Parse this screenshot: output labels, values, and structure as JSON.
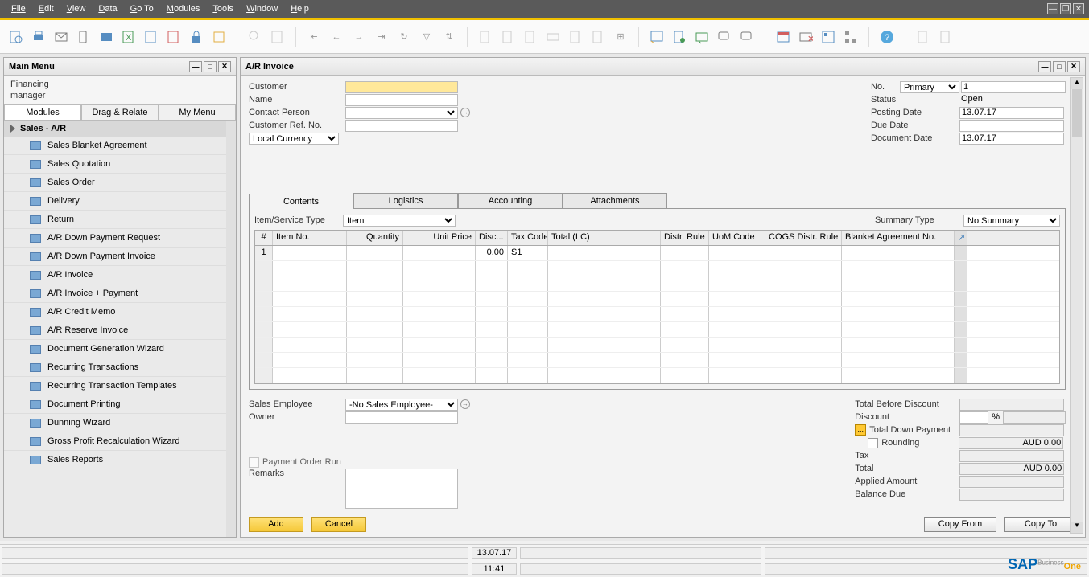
{
  "menubar": [
    "File",
    "Edit",
    "View",
    "Data",
    "Go To",
    "Modules",
    "Tools",
    "Window",
    "Help"
  ],
  "mainmenu": {
    "title": "Main Menu",
    "user_line1": "Financing",
    "user_line2": "manager",
    "tabs": [
      "Modules",
      "Drag & Relate",
      "My Menu"
    ],
    "section": "Sales - A/R",
    "items": [
      "Sales Blanket Agreement",
      "Sales Quotation",
      "Sales Order",
      "Delivery",
      "Return",
      "A/R Down Payment Request",
      "A/R Down Payment Invoice",
      "A/R Invoice",
      "A/R Invoice + Payment",
      "A/R Credit Memo",
      "A/R Reserve Invoice",
      "Document Generation Wizard",
      "Recurring Transactions",
      "Recurring Transaction Templates",
      "Document Printing",
      "Dunning Wizard",
      "Gross Profit Recalculation Wizard",
      "Sales Reports"
    ]
  },
  "invoice": {
    "title": "A/R Invoice",
    "left_fields": {
      "customer_label": "Customer",
      "name_label": "Name",
      "contact_label": "Contact Person",
      "ref_label": "Customer Ref. No.",
      "currency": "Local Currency"
    },
    "right_fields": {
      "no_label": "No.",
      "no_type": "Primary",
      "no_value": "1",
      "status_label": "Status",
      "status_value": "Open",
      "posting_label": "Posting Date",
      "posting_value": "13.07.17",
      "due_label": "Due Date",
      "due_value": "",
      "doc_label": "Document Date",
      "doc_value": "13.07.17"
    },
    "tabs": [
      "Contents",
      "Logistics",
      "Accounting",
      "Attachments"
    ],
    "type_row": {
      "item_service_label": "Item/Service Type",
      "item_service_value": "Item",
      "summary_label": "Summary Type",
      "summary_value": "No Summary"
    },
    "grid_headers": [
      "#",
      "Item No.",
      "Quantity",
      "Unit Price",
      "Disc...",
      "Tax Code",
      "Total (LC)",
      "Distr. Rule",
      "UoM Code",
      "COGS Distr. Rule",
      "Blanket Agreement No."
    ],
    "grid_row1": {
      "num": "1",
      "disc": "0.00",
      "tax": "S1"
    },
    "bottom_left": {
      "sales_emp_label": "Sales Employee",
      "sales_emp_value": "-No Sales Employee-",
      "owner_label": "Owner",
      "payment_order_label": "Payment Order Run",
      "remarks_label": "Remarks"
    },
    "bottom_right": {
      "total_before_label": "Total Before Discount",
      "discount_label": "Discount",
      "discount_pct": "%",
      "total_down_label": "Total Down Payment",
      "rounding_label": "Rounding",
      "rounding_value": "AUD 0.00",
      "tax_label": "Tax",
      "total_label": "Total",
      "total_value": "AUD 0.00",
      "applied_label": "Applied Amount",
      "balance_label": "Balance Due"
    },
    "buttons": {
      "add": "Add",
      "cancel": "Cancel",
      "copy_from": "Copy From",
      "copy_to": "Copy To"
    }
  },
  "statusbar": {
    "date": "13.07.17",
    "time": "11:41"
  }
}
